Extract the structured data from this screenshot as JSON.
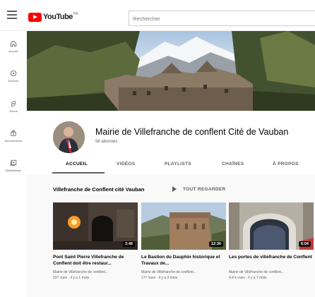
{
  "header": {
    "logo_text": "YouTube",
    "logo_sup": "FR",
    "search_placeholder": "Rechercher"
  },
  "sidebar": {
    "items": [
      {
        "label": "Accueil",
        "icon": "home-icon"
      },
      {
        "label": "Explorer",
        "icon": "compass-icon"
      },
      {
        "label": "Shorts",
        "icon": "shorts-icon"
      },
      {
        "label": "Abonnements",
        "icon": "subscriptions-icon"
      },
      {
        "label": "Bibliothèque",
        "icon": "library-icon"
      }
    ]
  },
  "channel": {
    "title": "Mairie de Villefranche de conflent Cité de Vauban",
    "subscribers": "56 abonnés"
  },
  "tabs": [
    {
      "label": "ACCUEIL",
      "active": true
    },
    {
      "label": "VIDÉOS"
    },
    {
      "label": "PLAYLISTS"
    },
    {
      "label": "CHAÎNES"
    },
    {
      "label": "À PROPOS"
    }
  ],
  "section": {
    "title": "Villefranche de Conflent cité Vauban",
    "play_all": "TOUT REGARDER"
  },
  "videos": [
    {
      "title": "Pont Saint Pierre Villefranche de Conflent doit être restaur...",
      "channel": "Mairie de Villefranche de conflent...",
      "meta": "227 vues · il y a 1 mois",
      "duration": "3:46"
    },
    {
      "title": "Le Bastion du Dauphin historique et Travaux de...",
      "channel": "Mairie de Villefranche de conflent...",
      "meta": "177 vues · il y a 3 mois",
      "duration": "12:30"
    },
    {
      "title": "Les portes de villefranche de Conflent",
      "channel": "Mairie de Villefranche de conflent...",
      "meta": "4,4 k vues · il y a 7 mois",
      "duration": "6:04"
    }
  ]
}
